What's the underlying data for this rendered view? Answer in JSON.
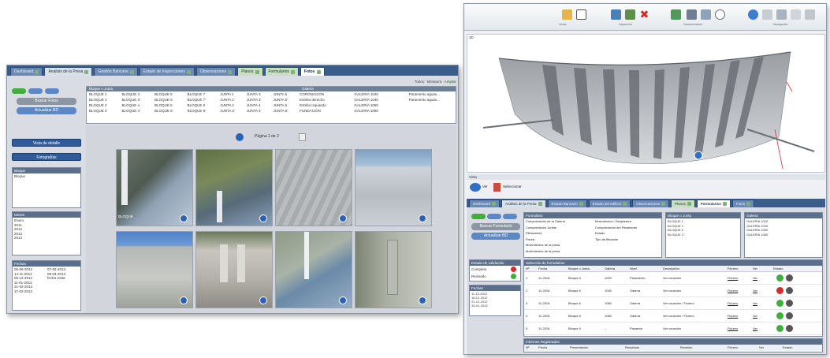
{
  "left_window": {
    "tabs": [
      {
        "label": "Dashboard",
        "style": "normal"
      },
      {
        "label": "Analisis de la Presa",
        "style": "light"
      },
      {
        "label": "Gestión Bancaria",
        "style": "normal"
      },
      {
        "label": "Estado de Inspecciones",
        "style": "normal"
      },
      {
        "label": "Observaciones",
        "style": "normal"
      },
      {
        "label": "Planos",
        "style": "green"
      },
      {
        "label": "Formularios",
        "style": "green"
      },
      {
        "label": "Fotos",
        "style": "active"
      }
    ],
    "buttons": {
      "search_label": "Buscar Fotos",
      "upload_label": "Actualizar BD",
      "detail_view_label": "Vista de detalle",
      "pictures_label": "Fotografías"
    },
    "filter_bar": {
      "option1": "Todos",
      "option2": "Miniatura",
      "option3": "Ampliar"
    },
    "table_header": {
      "col1": "Bloque o Junta",
      "col2": "Galería"
    },
    "table_rows": [
      [
        "BLOQUE 1",
        "BLOQUE 3",
        "BLOQUE 5",
        "BLOQUE 7",
        "JUNTA 1",
        "JUNTA 3",
        "JUNTA 5",
        "CORONACIÓN",
        "GALERÍA 1020",
        "Paramento aguas..."
      ],
      [
        "BLOQUE 1'",
        "BLOQUE 3'",
        "BLOQUE 5'",
        "BLOQUE 7'",
        "JUNTA 1'",
        "JUNTA 3'",
        "JUNTA 5'",
        "Estribo derecho",
        "GALERÍA 1040",
        "Paramento aguas..."
      ],
      [
        "BLOQUE 2",
        "BLOQUE 4",
        "BLOQUE 6",
        "BLOQUE 8",
        "JUNTA 2",
        "JUNTA 4",
        "JUNTA 6",
        "Estribo izquierdo",
        "GALERÍA 1060",
        ""
      ],
      [
        "BLOQUE 2'",
        "BLOQUE 4'",
        "BLOQUE 6'",
        "BLOQUE 8'",
        "JUNTA 2'",
        "JUNTA 4'",
        "JUNTA 6'",
        "FUNDACIÓN",
        "GALERÍA 1080",
        ""
      ]
    ],
    "pagination": "Página 1 de 2",
    "photo_caption": "BLOQUE",
    "panels": {
      "panel1_title": "Bloque",
      "panel1_items": [
        "Bloque"
      ],
      "panel2_title": "Meses",
      "panel2_items": [
        "Enero",
        "2011",
        "2012",
        "2013",
        "2014"
      ],
      "panel3_title": "Fechas",
      "panel3_items": [
        [
          "05-06-2012",
          "07-02-2013"
        ],
        [
          "14-11-2012",
          "08-04-2013"
        ],
        [
          "06-12-2012",
          "fecha visita"
        ],
        [
          "11-01-2013",
          ""
        ],
        [
          "21-02-2013",
          ""
        ],
        [
          "17-02-2013",
          ""
        ]
      ]
    }
  },
  "right_window": {
    "toolbar_groups": [
      "Vistas",
      "Inspección",
      "Documentación",
      "Navegación"
    ],
    "viewer_header": "3D",
    "sub_panel_title": "Vista",
    "sub_toolbar": {
      "btn1": "Ver",
      "btn2": "Seleccionar"
    },
    "tabs": [
      {
        "label": "Dashboard",
        "style": "normal"
      },
      {
        "label": "Análisis de la Presa",
        "style": "light"
      },
      {
        "label": "Estado Bancario",
        "style": "normal"
      },
      {
        "label": "Estado del edificio",
        "style": "normal"
      },
      {
        "label": "Observaciones",
        "style": "normal"
      },
      {
        "label": "Planos",
        "style": "green"
      },
      {
        "label": "Formularios",
        "style": "active"
      },
      {
        "label": "Fotos",
        "style": "normal"
      }
    ],
    "side_buttons": {
      "search": "Buscar Formulario",
      "update": "Actualizar BD"
    },
    "form_sections": {
      "header1": "Formulario",
      "header2": "Bloque o Junta",
      "header3": "Galería",
      "rows": [
        [
          "Comprobación de la Galería",
          "Movimientos / Desplazam."
        ],
        [
          "Comprobación Juntas",
          "Comprobación del Paramento"
        ],
        [
          "Filtraciones",
          "Estado"
        ],
        [
          "Fisura",
          "Tipo de filtración"
        ],
        [
          "Movimientos de la presa",
          ""
        ],
        [
          "Movimientos de la presa",
          ""
        ]
      ]
    },
    "status_panel": {
      "title": "Estado de validación",
      "row1": "Completo",
      "row2": "Revisado"
    },
    "dates_panel": {
      "title": "Fechas",
      "items": [
        "11-12-2012",
        "18-12-2012",
        "21-12-2012",
        "15-01-2013"
      ]
    },
    "results_title": "Selección de formularios",
    "results_header": [
      "Nº",
      "Fecha",
      "Bloque o Junta",
      "Galería",
      "Nivel",
      "Descripción",
      "Fichero",
      "Ver",
      "Estado"
    ],
    "results_rows": [
      [
        "1",
        "11-2016",
        "Bloque 6",
        "1020",
        "Paramento",
        "Ver conexión",
        "Fichero",
        "Ver"
      ],
      [
        "2",
        "11-2016",
        "Bloque 6",
        "1040",
        "Galería",
        "Ver conexión",
        "Fichero",
        "Ver"
      ],
      [
        "3",
        "11-2016",
        "Bloque 6",
        "1060",
        "Galería",
        "Ver conexión / Fichero",
        "Fichero",
        "Ver"
      ],
      [
        "4",
        "11-2016",
        "Bloque 6",
        "1080",
        "Galería",
        "Ver conexión / Fichero",
        "Fichero",
        "Ver"
      ],
      [
        "5",
        "11-2016",
        "Bloque 6",
        "--",
        "Pasarela",
        "Ver conexión",
        "Fichero",
        "Ver"
      ]
    ],
    "bottom_title": "Informes Registrados",
    "bottom_header": [
      "Nº",
      "Fecha",
      "Presentación",
      "Resultado",
      "Revisión",
      "Fichero",
      "Ver",
      "Estado"
    ]
  },
  "colors": {
    "nav_blue": "#3a5d8c",
    "accent_blue": "#2f5b9a",
    "green_status": "#3fae3a",
    "red_status": "#d42b2b"
  }
}
